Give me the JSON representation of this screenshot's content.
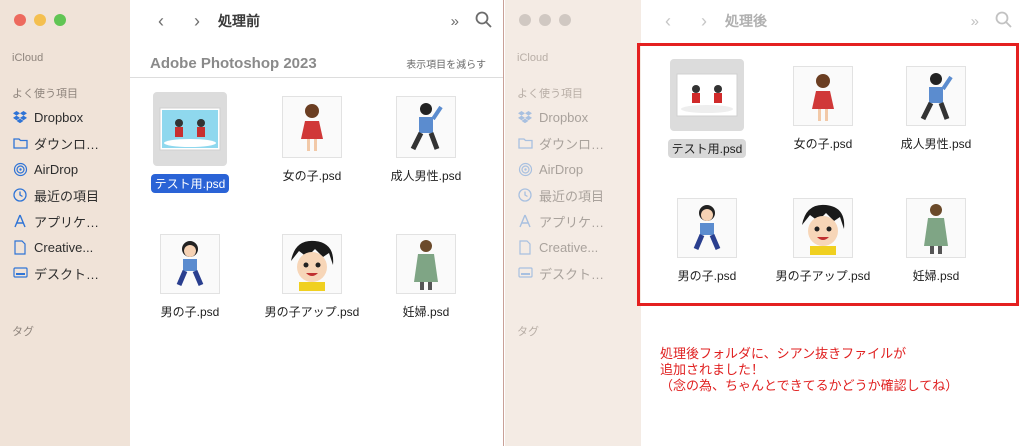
{
  "left_window": {
    "title": "処理前",
    "sidebar": {
      "section_icloud": "iCloud",
      "section_favorites": "よく使う項目",
      "items": [
        {
          "label": "Dropbox",
          "icon": "dropbox-icon"
        },
        {
          "label": "ダウンロ…",
          "icon": "folder-icon"
        },
        {
          "label": "AirDrop",
          "icon": "airdrop-icon"
        },
        {
          "label": "最近の項目",
          "icon": "clock-icon"
        },
        {
          "label": "アプリケ…",
          "icon": "apps-icon"
        },
        {
          "label": "Creative...",
          "icon": "document-icon"
        },
        {
          "label": "デスクト…",
          "icon": "desktop-icon"
        }
      ],
      "section_tags": "タグ"
    },
    "toolbar": {
      "back": "‹",
      "forward": "›",
      "more": "»",
      "search": "⌕"
    },
    "group": {
      "title": "Adobe Photoshop 2023",
      "action": "表示項目を減らす"
    },
    "files": [
      {
        "name": "テスト用.psd",
        "selected": true
      },
      {
        "name": "女の子.psd"
      },
      {
        "name": "成人男性.psd"
      },
      {
        "name": "男の子.psd"
      },
      {
        "name": "男の子アップ.psd"
      },
      {
        "name": "妊婦.psd"
      }
    ]
  },
  "right_window": {
    "title": "処理後",
    "sidebar": {
      "section_icloud": "iCloud",
      "section_favorites": "よく使う項目",
      "items": [
        {
          "label": "Dropbox",
          "icon": "dropbox-icon"
        },
        {
          "label": "ダウンロ…",
          "icon": "folder-icon"
        },
        {
          "label": "AirDrop",
          "icon": "airdrop-icon"
        },
        {
          "label": "最近の項目",
          "icon": "clock-icon"
        },
        {
          "label": "アプリケ…",
          "icon": "apps-icon"
        },
        {
          "label": "Creative...",
          "icon": "document-icon"
        },
        {
          "label": "デスクト…",
          "icon": "desktop-icon"
        }
      ],
      "section_tags": "タグ"
    },
    "toolbar": {
      "back": "‹",
      "forward": "›",
      "more": "»",
      "search": "⌕"
    },
    "files": [
      {
        "name": "テスト用.psd",
        "selected": true
      },
      {
        "name": "女の子.psd"
      },
      {
        "name": "成人男性.psd"
      },
      {
        "name": "男の子.psd"
      },
      {
        "name": "男の子アップ.psd"
      },
      {
        "name": "妊婦.psd"
      }
    ]
  },
  "annotation": {
    "lines": [
      "処理後フォルダに、シアン抜きファイルが",
      "追加されました！",
      "（念の為、ちゃんとできてるかどうか確認してね）"
    ],
    "color": "#e42020"
  }
}
